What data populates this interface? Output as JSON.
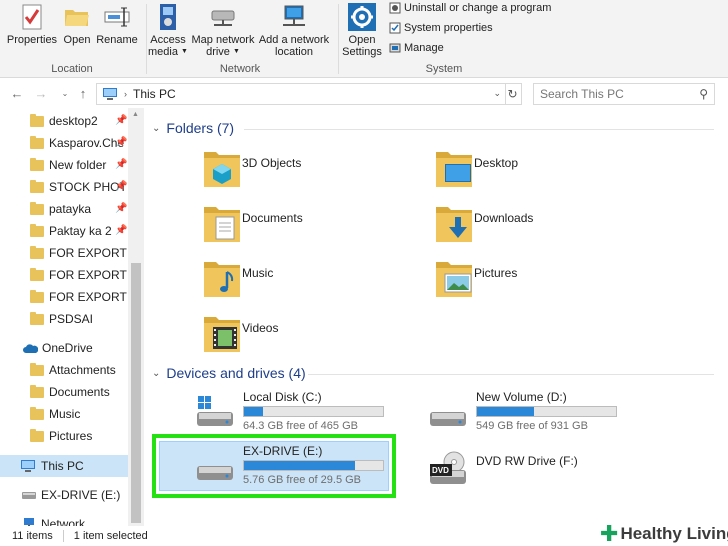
{
  "ribbon": {
    "location_group": "Location",
    "network_group": "Network",
    "system_group": "System",
    "properties": "Properties",
    "open": "Open",
    "rename": "Rename",
    "access_media_1": "Access",
    "access_media_2": "media",
    "map_drive_1": "Map network",
    "map_drive_2": "drive",
    "add_location_1": "Add a network",
    "add_location_2": "location",
    "open_settings_1": "Open",
    "open_settings_2": "Settings",
    "uninstall": "Uninstall or change a program",
    "system_properties": "System properties",
    "manage": "Manage"
  },
  "address": {
    "path": "This PC",
    "search_placeholder": "Search This PC"
  },
  "nav": {
    "items": [
      {
        "label": "desktop2",
        "pinned": true
      },
      {
        "label": "Kasparov.Che",
        "pinned": true
      },
      {
        "label": "New folder",
        "pinned": true
      },
      {
        "label": "STOCK PHOT",
        "pinned": true
      },
      {
        "label": "patayka",
        "pinned": true
      },
      {
        "label": "Paktay ka 2",
        "pinned": true
      },
      {
        "label": "FOR EXPORT",
        "pinned": false
      },
      {
        "label": "FOR EXPORT",
        "pinned": false
      },
      {
        "label": "FOR EXPORT",
        "pinned": false
      },
      {
        "label": "PSDSAI",
        "pinned": false
      }
    ],
    "onedrive": "OneDrive",
    "onedrive_items": [
      "Attachments",
      "Documents",
      "Music",
      "Pictures"
    ],
    "this_pc": "This PC",
    "ex_drive": "EX-DRIVE (E:)",
    "network": "Network"
  },
  "content": {
    "folders_header": "Folders (7)",
    "folders": [
      "3D Objects",
      "Desktop",
      "Documents",
      "Downloads",
      "Music",
      "Pictures",
      "Videos"
    ],
    "devices_header": "Devices and drives (4)",
    "drives": [
      {
        "name": "Local Disk (C:)",
        "free": "64.3 GB free of 465 GB",
        "used_fraction": 0.14
      },
      {
        "name": "New Volume (D:)",
        "free": "549 GB free of 931 GB",
        "used_fraction": 0.41
      },
      {
        "name": "EX-DRIVE (E:)",
        "free": "5.76 GB free of 29.5 GB",
        "used_fraction": 0.8
      },
      {
        "name": "DVD RW Drive (F:)"
      }
    ],
    "dvd_badge": "DVD"
  },
  "status": {
    "items": "11 items",
    "selected": "1 item selected"
  },
  "watermark": {
    "text": "Healthy Living"
  },
  "colors": {
    "accent": "#2b88d8",
    "highlight": "#25e012",
    "selection": "#cce4f7",
    "group_header": "#1e3e8a"
  }
}
